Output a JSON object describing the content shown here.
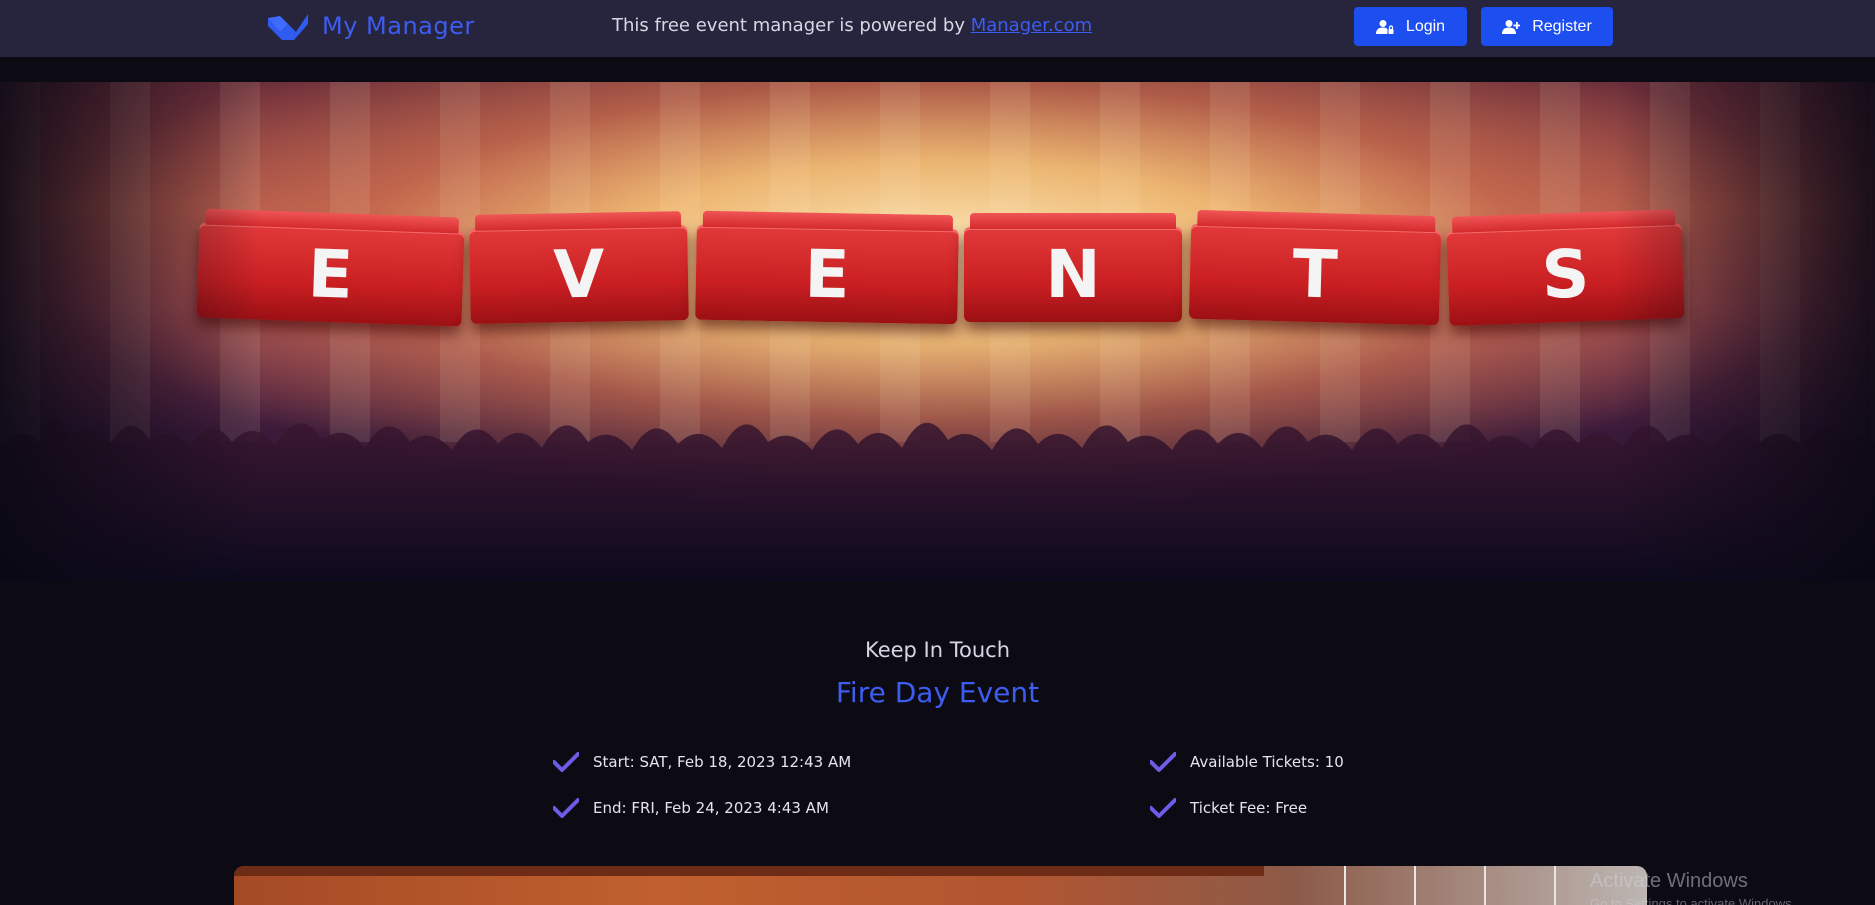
{
  "navbar": {
    "brand_name": "My Manager",
    "powered_prefix": "This free event manager is powered by ",
    "powered_link": "Manager.com",
    "login_label": "Login",
    "register_label": "Register",
    "accent": "#1d4ef0"
  },
  "hero": {
    "cube_letters": [
      "E",
      "V",
      "E",
      "N",
      "T",
      "S"
    ]
  },
  "event": {
    "subtitle": "Keep In Touch",
    "title": "Fire Day Event",
    "start": "Start: SAT, Feb 18, 2023 12:43 AM",
    "end": "End: FRI, Feb 24, 2023 4:43 AM",
    "tickets": "Available Tickets: 10",
    "fee": "Ticket Fee: Free",
    "check_icon": "check-icon",
    "check_color": "#6c5ce7"
  },
  "os_watermark": {
    "line1": "Activate Windows",
    "line2": "Go to Settings to activate Windows."
  }
}
